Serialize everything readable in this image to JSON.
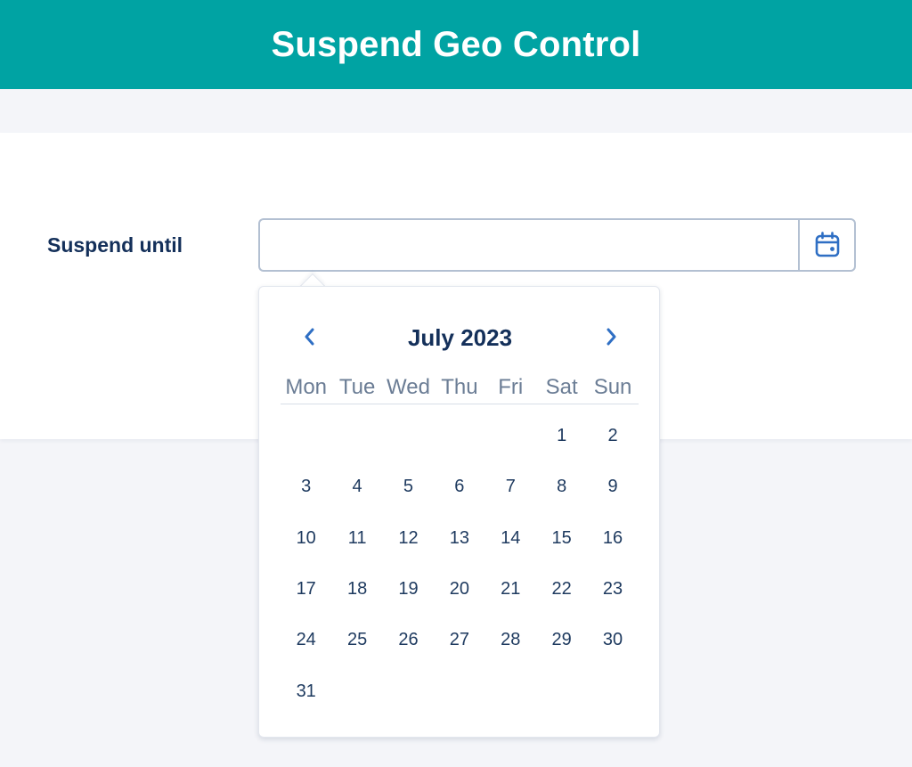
{
  "header": {
    "title": "Suspend Geo Control"
  },
  "form": {
    "label": "Suspend until",
    "date_value": "",
    "calendar_button_icon": "calendar-icon"
  },
  "datepicker": {
    "month_title": "July 2023",
    "prev_icon": "chevron-left-icon",
    "next_icon": "chevron-right-icon",
    "weekdays": [
      "Mon",
      "Tue",
      "Wed",
      "Thu",
      "Fri",
      "Sat",
      "Sun"
    ],
    "leading_blank_days": 5,
    "days": [
      "1",
      "2",
      "3",
      "4",
      "5",
      "6",
      "7",
      "8",
      "9",
      "10",
      "11",
      "12",
      "13",
      "14",
      "15",
      "16",
      "17",
      "18",
      "19",
      "20",
      "21",
      "22",
      "23",
      "24",
      "25",
      "26",
      "27",
      "28",
      "29",
      "30",
      "31"
    ]
  },
  "colors": {
    "header_bg": "#00a3a3",
    "accent": "#2f6fc4",
    "text_dark": "#14305a",
    "weekday_text": "#6b7d95"
  }
}
